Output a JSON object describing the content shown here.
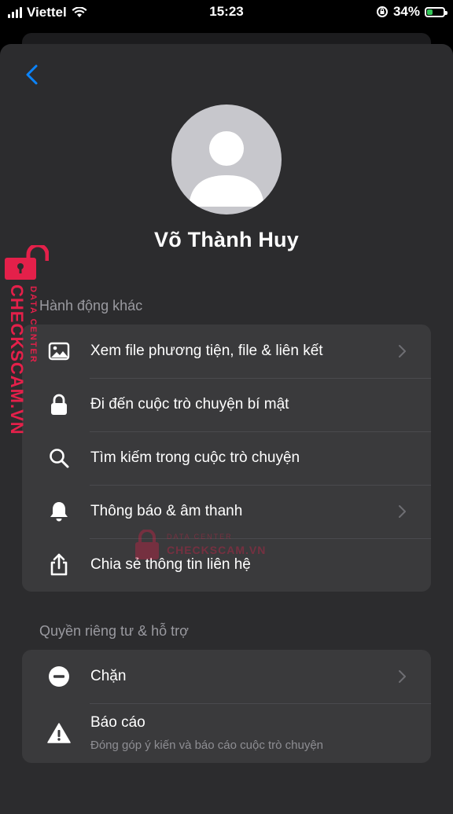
{
  "status": {
    "carrier": "Viettel",
    "time": "15:23",
    "battery_percent": "34%",
    "battery_level": 0.34,
    "signal_bars": 4
  },
  "profile": {
    "name": "Võ Thành Huy"
  },
  "sections": {
    "other_actions": {
      "title": "Hành động khác",
      "items": [
        {
          "label": "Xem file phương tiện, file & liên kết",
          "icon": "photo-icon",
          "chevron": true
        },
        {
          "label": "Đi đến cuộc trò chuyện bí mật",
          "icon": "lock-icon",
          "chevron": false
        },
        {
          "label": "Tìm kiếm trong cuộc trò chuyện",
          "icon": "search-icon",
          "chevron": false
        },
        {
          "label": "Thông báo & âm thanh",
          "icon": "bell-icon",
          "chevron": true
        },
        {
          "label": "Chia sẻ thông tin liên hệ",
          "icon": "share-icon",
          "chevron": false
        }
      ]
    },
    "privacy_support": {
      "title": "Quyền riêng tư & hỗ trợ",
      "items": [
        {
          "label": "Chặn",
          "icon": "block-icon",
          "chevron": true
        },
        {
          "label": "Báo cáo",
          "sublabel": "Đóng góp ý kiến và báo cáo cuộc trò chuyện",
          "icon": "warning-icon",
          "chevron": false
        }
      ]
    }
  },
  "watermark": {
    "brand": "CHECKSCAM.VN",
    "tagline": "DATA CENTER"
  },
  "colors": {
    "accent": "#0a84ff",
    "sheet": "#2c2c2e",
    "group": "#3a3a3c",
    "watermark": "#e4204a"
  }
}
